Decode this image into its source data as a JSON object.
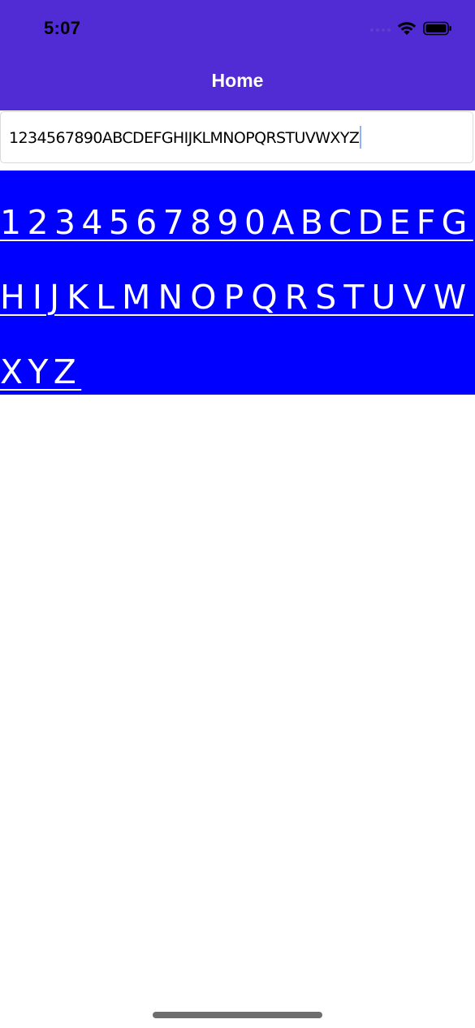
{
  "status_bar": {
    "time": "5:07",
    "icons": [
      "signal-dots-icon",
      "wifi-icon",
      "battery-icon"
    ]
  },
  "nav": {
    "title": "Home"
  },
  "entry": {
    "value": "1234567890ABCDEFGHIJKLMNOPQRSTUVWXYZ"
  },
  "label": {
    "lines": [
      "1234567890ABCDEFG",
      "HIJKLMNOPQRSTUVW",
      "XYZ"
    ]
  },
  "colors": {
    "header": "#512BD4",
    "label_background": "#0000FF",
    "label_text": "#FFFFFF"
  }
}
